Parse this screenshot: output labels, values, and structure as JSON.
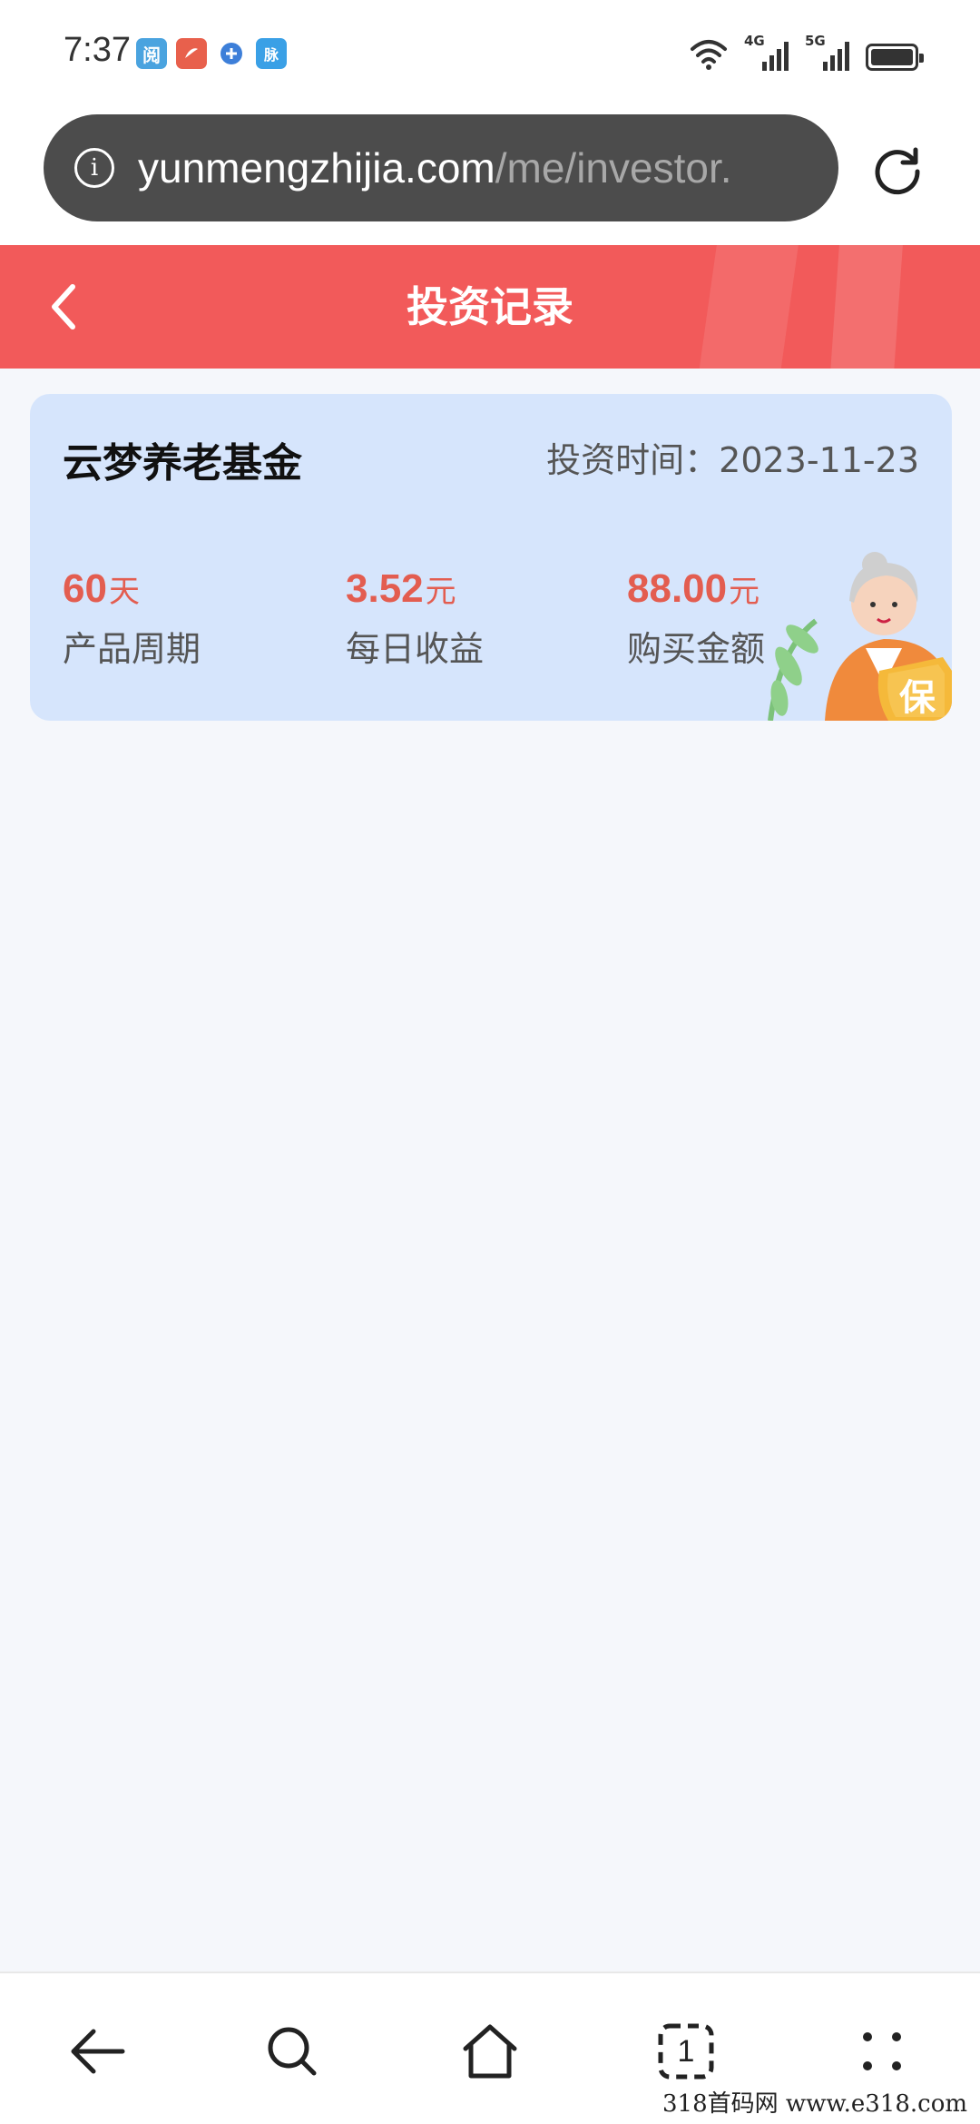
{
  "status_bar": {
    "time": "7:37",
    "notifications": [
      {
        "name": "reader-app-icon",
        "glyph": "阅",
        "color": "#4aa3df"
      },
      {
        "name": "red-app-icon",
        "glyph": "●",
        "color": "#e8604c"
      },
      {
        "name": "blue-app-icon",
        "glyph": "●",
        "color": "#3d7fd9"
      },
      {
        "name": "chat-app-icon",
        "glyph": "脉",
        "color": "#3aa0e6"
      }
    ],
    "network_1": "4G",
    "network_2": "5G"
  },
  "browser": {
    "url_host": "yunmengzhijia.com",
    "url_path": "/me/investor."
  },
  "header": {
    "title": "投资记录"
  },
  "record": {
    "fund_name": "云梦养老基金",
    "invest_time": "投资时间：2023-11-23",
    "stats": [
      {
        "value": "60",
        "unit": "天",
        "label": "产品周期"
      },
      {
        "value": "3.52",
        "unit": "元",
        "label": "每日收益"
      },
      {
        "value": "88.00",
        "unit": "元",
        "label": "购买金额"
      }
    ],
    "badge_char": "保"
  },
  "bottom_nav": {
    "tab_count": "1"
  },
  "watermark": "318首码网 www.e318.com",
  "colors": {
    "header_red": "#f25a5a",
    "card_blue": "#d6e5fc",
    "value_red": "#e35d50"
  }
}
